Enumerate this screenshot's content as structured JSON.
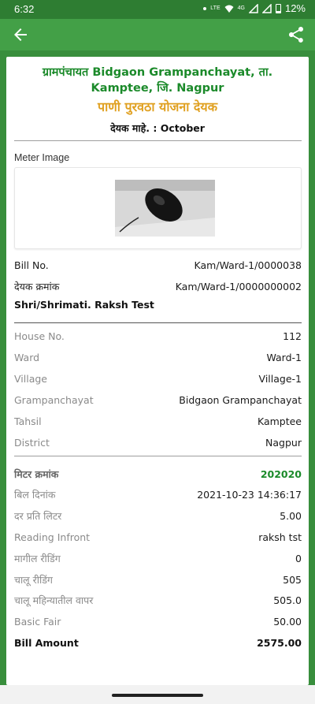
{
  "status_bar": {
    "time": "6:32",
    "network_label": "4G",
    "lte_label": "LTE",
    "battery": "12%"
  },
  "app_bar": {
    "back_icon": "arrow-left",
    "share_icon": "share"
  },
  "bill": {
    "header_line1": "ग्रामपंचायत Bidgaon Grampanchayat, ता.",
    "header_line2": "Kamptee, जि. Nagpur",
    "scheme_title": "पाणी पुरवठा योजना देयक",
    "month_line": "देयक माहे. : October",
    "meter_image_label": "Meter Image",
    "bill_no_label": "Bill No.",
    "bill_no_value": "Kam/Ward-1/0000038",
    "deyak_kramank_label": "देयक क्रमांक",
    "deyak_kramank_value": "Kam/Ward-1/0000000002",
    "customer_name": "Shri/Shrimati.  Raksh  Test"
  },
  "address_rows": [
    {
      "label": "House No.",
      "value": "112"
    },
    {
      "label": "Ward",
      "value": "Ward-1"
    },
    {
      "label": "Village",
      "value": "Village-1"
    },
    {
      "label": "Grampanchayat",
      "value": "Bidgaon Grampanchayat"
    },
    {
      "label": "Tahsil",
      "value": "Kamptee"
    },
    {
      "label": "District",
      "value": "Nagpur"
    }
  ],
  "meter_rows": {
    "meter_no": {
      "label": "मिटर क्रमांक",
      "value": "202020"
    },
    "bill_date": {
      "label": "बिल दिनांक",
      "value": "2021-10-23 14:36:17"
    },
    "rate": {
      "label": "दर प्रति लिटर",
      "value": "5.00"
    },
    "reading_infront": {
      "label": "Reading Infront",
      "value": "raksh tst"
    },
    "prev_reading": {
      "label": "मागील रीडिंग",
      "value": "0"
    },
    "current_reading": {
      "label": "चालू रीडिंग",
      "value": "505"
    },
    "monthly_usage": {
      "label": "चालू महिन्यातील वापर",
      "value": "505.0"
    },
    "basic_fair": {
      "label": "Basic Fair",
      "value": "50.00"
    },
    "bill_amount": {
      "label": "Bill Amount",
      "value": "2575.00"
    }
  },
  "colors": {
    "status_bar": "#2e7d32",
    "app_bar": "#43a047",
    "header_green": "#1b8a2a",
    "title_orange": "#e0a020"
  }
}
